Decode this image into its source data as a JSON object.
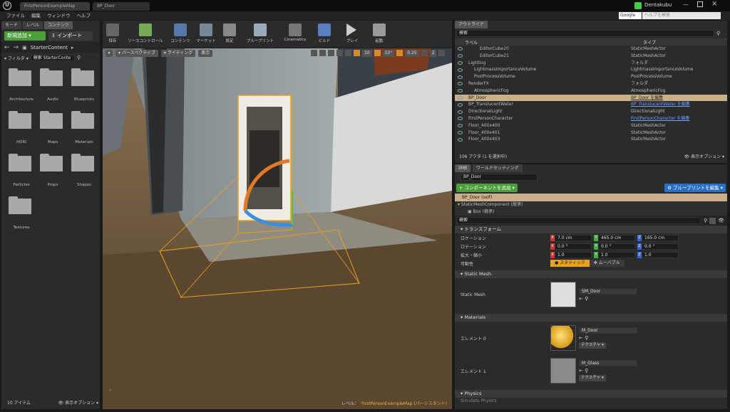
{
  "window": {
    "tabs": [
      "FirstPersonExampleMap",
      "BP_Door"
    ],
    "user": "Dentakubu",
    "search_engine": "Google",
    "help_placeholder": "ヘルプを検索"
  },
  "menu": [
    "ファイル",
    "編集",
    "ウィンドウ",
    "ヘルプ"
  ],
  "left_tabs": [
    "モード",
    "レベル",
    "コンテンツ"
  ],
  "content_browser": {
    "add_new": "新規追加",
    "import": "インポート",
    "path": "StarterContent",
    "filter": "フィルタ",
    "search_placeholder": "検索 StarterConte",
    "folders": [
      "Architecture",
      "Audio",
      "Blueprints",
      "HDRI",
      "Maps",
      "Materials",
      "Particles",
      "Props",
      "Shapes",
      "Textures"
    ],
    "item_count": "10 アイテム",
    "view_options": "表示オプション"
  },
  "toolbar": [
    "保存",
    "ソースコントロール",
    "コンテンツ",
    "マーケット",
    "設定",
    "ブループリント",
    "Cinematics",
    "ビルド",
    "プレイ",
    "起動"
  ],
  "viewport": {
    "perspective": "パースペクティブ",
    "lighting": "ライティング",
    "show": "表示",
    "snap_angle": "10°",
    "snap_scale": "0.25",
    "camera_speed": "2",
    "snap_grid": "10",
    "level_label": "レベル：",
    "level_name": "FirstPersonExampleMap (パーシスタント)"
  },
  "outliner": {
    "tab": "アウトライナ",
    "search_placeholder": "検索",
    "col_label": "ラベル",
    "col_type": "タイプ",
    "rows": [
      {
        "label": "EditorCube20",
        "type": "StaticMeshActor",
        "indent": 3
      },
      {
        "label": "EditorCube21",
        "type": "StaticMeshActor",
        "indent": 3
      },
      {
        "label": "Lighting",
        "type": "フォルダ",
        "indent": 1
      },
      {
        "label": "LightmassImportanceVolume",
        "type": "LightmassImportanceVolume",
        "indent": 2
      },
      {
        "label": "PostProcessVolume",
        "type": "PostProcessVolume",
        "indent": 2
      },
      {
        "label": "RenderFX",
        "type": "フォルダ",
        "indent": 1
      },
      {
        "label": "AtmosphericFog",
        "type": "AtmosphericFog",
        "indent": 2
      },
      {
        "label": "BP_Door",
        "type": "BP_Door を編集",
        "indent": 1
      },
      {
        "label": "BP_TranslucentWater",
        "type": "BP_TranslucentWater を編集",
        "indent": 1
      },
      {
        "label": "DirectionalLight",
        "type": "DirectionalLight",
        "indent": 1
      },
      {
        "label": "FirstPersonCharacter",
        "type": "FirstPersonCharacter を編集",
        "indent": 1
      },
      {
        "label": "Floor_400x400",
        "type": "StaticMeshActor",
        "indent": 1
      },
      {
        "label": "Floor_400x401",
        "type": "StaticMeshActor",
        "indent": 1
      },
      {
        "label": "Floor_400x403",
        "type": "StaticMeshActor",
        "indent": 1
      }
    ],
    "status": "106 アクタ (1 を選択中)",
    "view_options": "表示オプション"
  },
  "details": {
    "tab": "詳細",
    "world_settings_tab": "ワールドセッティング",
    "actor_name": "BP_Door",
    "add_component": "コンポーネントを追加",
    "edit_blueprint": "ブループリントを編集",
    "self": "BP_Door (self)",
    "component": "StaticMeshComponent (継承)",
    "subcomponent": "Box (継承)",
    "search_placeholder": "検索",
    "transform_header": "トランスフォーム",
    "location_label": "ロケーション",
    "rotation_label": "ロテーション",
    "scale_label": "拡大・縮小",
    "mobility_label": "可動性",
    "location": [
      "7.0 cm",
      "465.0 cm",
      "165.0 cm"
    ],
    "rotation": [
      "0.0 °",
      "0.0 °",
      "0.0 °"
    ],
    "scale": [
      "1.0",
      "1.0",
      "1.0"
    ],
    "static_btn": "スタティック",
    "movable_btn": "ムーバブル",
    "static_mesh_header": "Static Mesh",
    "static_mesh_label": "Static Mesh",
    "static_mesh_value": "SM_Door",
    "materials_header": "Materials",
    "element0_label": "エレメント 0",
    "element0_value": "M_Door",
    "element1_label": "エレメント 1",
    "element1_value": "M_Glass",
    "textures_btn": "テクスチャ",
    "physics_header": "Physics",
    "simulate_physics": "Simulate Physics"
  }
}
